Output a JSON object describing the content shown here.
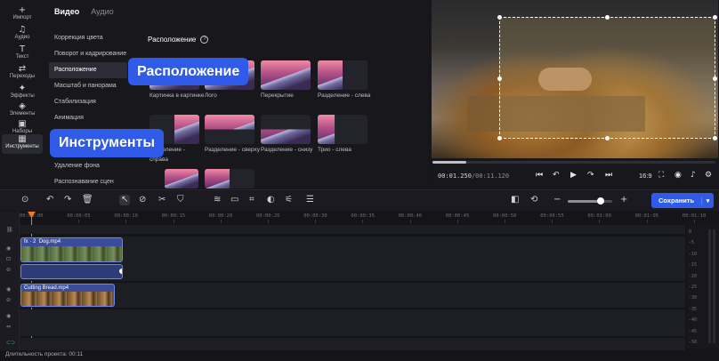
{
  "rail": {
    "items": [
      {
        "icon": "+",
        "label": "Импорт"
      },
      {
        "icon": "♫",
        "label": "Аудио"
      },
      {
        "icon": "T",
        "label": "Текст"
      },
      {
        "icon": "⇄",
        "label": "Переходы"
      },
      {
        "icon": "✦",
        "label": "Эффекты"
      },
      {
        "icon": "◈",
        "label": "Элементы"
      },
      {
        "icon": "▣",
        "label": "Наборы"
      },
      {
        "icon": "▦",
        "label": "Инструменты"
      }
    ]
  },
  "panel": {
    "tabs": [
      "Видео",
      "Аудио"
    ],
    "categories": [
      "Коррекция цвета",
      "Поворот и кадрирование",
      "Расположение",
      "Масштаб и панорама",
      "Стабилизация",
      "Анимация",
      "",
      "",
      "Удаление фона",
      "Распознавание сцен"
    ],
    "section_title": "Расположение",
    "presets": [
      {
        "label": "Картинка в картинке"
      },
      {
        "label": "Лого"
      },
      {
        "label": "Перекрытие"
      },
      {
        "label": "Разделение - слева"
      },
      {
        "label": "Разделение - справа"
      },
      {
        "label": "Разделение - сверху"
      },
      {
        "label": "Разделение - снизу"
      },
      {
        "label": "Трио - слева"
      }
    ]
  },
  "callouts": {
    "placement": "Расположение",
    "tools": "Инструменты"
  },
  "preview": {
    "timecode_current": "00:01.250",
    "timecode_total": "/00:11.120",
    "progress": 0.12,
    "aspect_ratio": "16:9"
  },
  "toolbar": {
    "save_label": "Сохранить"
  },
  "timeline": {
    "ticks": [
      "00:00:00",
      "00:00:05",
      "00:00:10",
      "00:00:15",
      "00:00:20",
      "00:00:25",
      "00:00:30",
      "00:00:35",
      "00:00:40",
      "00:00:45",
      "00:00:50",
      "00:00:55",
      "00:01:00",
      "00:01:05",
      "00:01:10"
    ],
    "clips": [
      {
        "name": "Dog.mp4",
        "fx_badge": "fx · 2"
      },
      {
        "name": "Cutting Bread.mp4"
      }
    ],
    "vu_labels": [
      "0",
      "-5",
      "-10",
      "-15",
      "-20",
      "-25",
      "-30",
      "-35",
      "-40",
      "-45",
      "-50"
    ]
  },
  "status": {
    "duration": "Длительность проекта: 00:11"
  },
  "colors": {
    "accent": "#2f5be8",
    "playhead": "#f07a1e",
    "background": "#141419"
  }
}
